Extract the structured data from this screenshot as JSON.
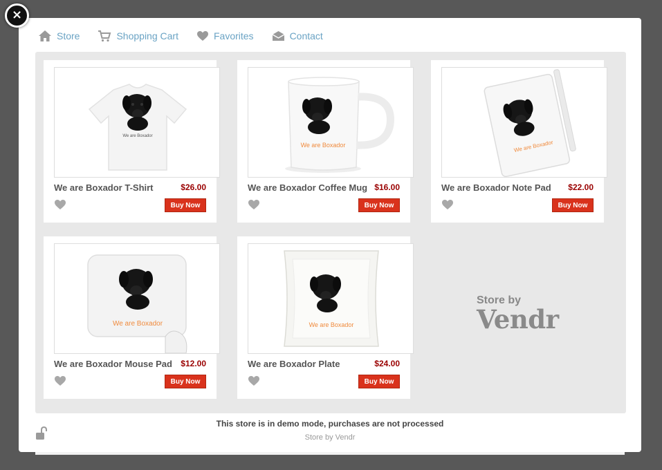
{
  "close": {
    "glyph": "×"
  },
  "nav": [
    {
      "label": "Store",
      "icon": "home-icon"
    },
    {
      "label": "Shopping Cart",
      "icon": "cart-icon"
    },
    {
      "label": "Favorites",
      "icon": "heart-icon"
    },
    {
      "label": "Contact",
      "icon": "envelope-icon"
    }
  ],
  "products": [
    {
      "name": "We are Boxador T-Shirt",
      "price": "$26.00",
      "buy_label": "Buy Now",
      "image": "tshirt",
      "image_text": "We are Boxador"
    },
    {
      "name": "We are Boxador Coffee Mug",
      "price": "$16.00",
      "buy_label": "Buy Now",
      "image": "mug",
      "image_text": "We are Boxador"
    },
    {
      "name": "We are Boxador Note Pad",
      "price": "$22.00",
      "buy_label": "Buy Now",
      "image": "notepad",
      "image_text": "We are Boxador"
    },
    {
      "name": "We are Boxador Mouse Pad",
      "price": "$12.00",
      "buy_label": "Buy Now",
      "image": "mousepad",
      "image_text": "We are Boxador"
    },
    {
      "name": "We are Boxador Plate",
      "price": "$24.00",
      "buy_label": "Buy Now",
      "image": "plate",
      "image_text": "We are Boxador"
    }
  ],
  "badge": {
    "small": "Store by",
    "big": "Vendr"
  },
  "footer": {
    "notice": "This store is in demo mode, purchases are not processed",
    "credit": "Store by Vendr"
  },
  "colors": {
    "accent": "#6aa3c4",
    "buy": "#d9321c",
    "price": "#9a0000",
    "image_text_orange": "#f08a3c"
  }
}
